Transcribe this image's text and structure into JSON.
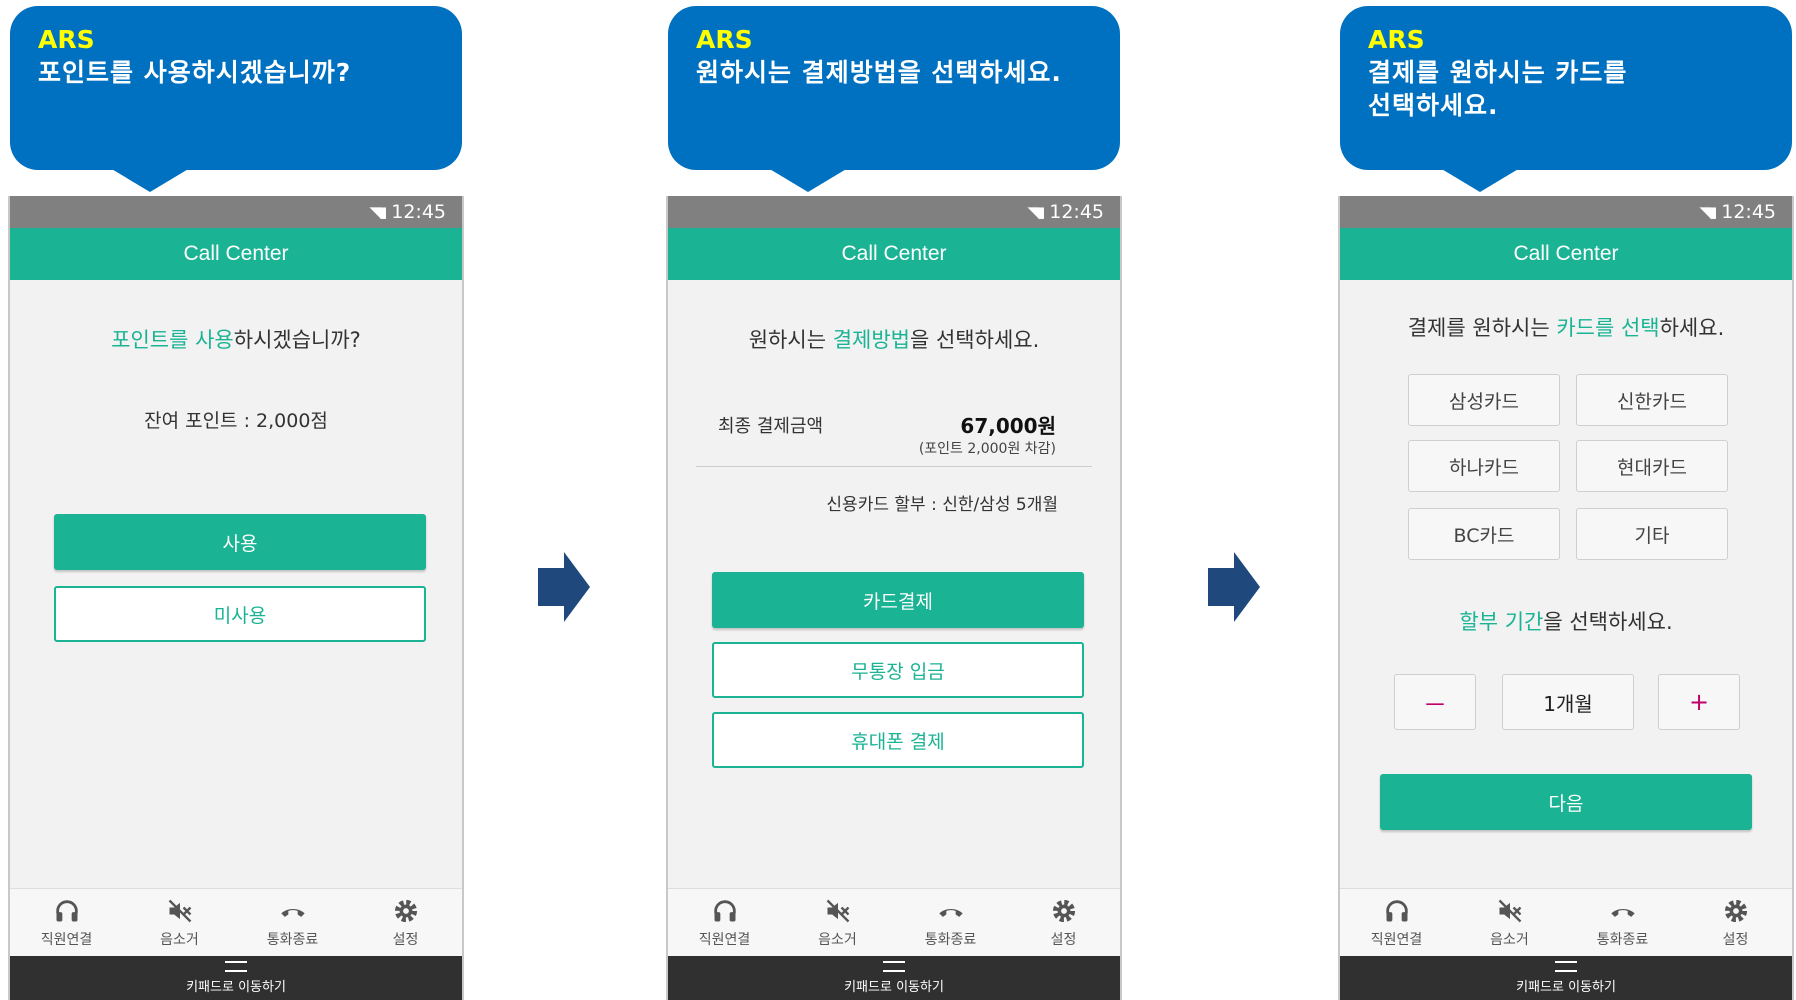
{
  "status": {
    "time": "12:45"
  },
  "app_title": "Call Center",
  "nav_label": "키패드로 이동하기",
  "tabs": [
    "직원연결",
    "음소거",
    "통화종료",
    "설정"
  ],
  "screen1": {
    "ars_tag": "ARS",
    "ars_msg": "포인트를 사용하시겠습니까?",
    "prompt": {
      "hl": "포인트를 사용",
      "rest": "하시겠습니까?"
    },
    "balance": "잔여 포인트 : 2,000점",
    "use_label": "사용",
    "no_use_label": "미사용"
  },
  "screen2": {
    "ars_tag": "ARS",
    "ars_msg": "원하시는 결제방법을 선택하세요.",
    "prompt": {
      "pre": "원하시는 ",
      "hl": "결제방법",
      "rest": "을 선택하세요."
    },
    "total_label": "최종 결제금액",
    "total_amount": "67,000원",
    "total_note": "(포인트 2,000원 차감)",
    "installment_note": "신용카드 할부 : 신한/삼성 5개월",
    "card_pay": "카드결제",
    "bank_transfer": "무통장 입금",
    "phone_pay": "휴대폰 결제"
  },
  "screen3": {
    "ars_tag": "ARS",
    "ars_msg": "결제를 원하시는 카드를 선택하세요.",
    "prompt": {
      "pre": "결제를 원하시는 ",
      "hl": "카드를 선택",
      "rest": "하세요."
    },
    "cards": [
      "삼성카드",
      "신한카드",
      "하나카드",
      "현대카드",
      "BC카드",
      "기타"
    ],
    "period_prompt": {
      "hl": "할부 기간",
      "rest": "을 선택하세요."
    },
    "minus": "－",
    "plus": "+",
    "period_value": "1개월",
    "next": "다음"
  },
  "colors": {
    "accent": "#1ab394",
    "bubble": "#0070c0",
    "tag": "#ffff00",
    "arrow": "#1f497d"
  }
}
